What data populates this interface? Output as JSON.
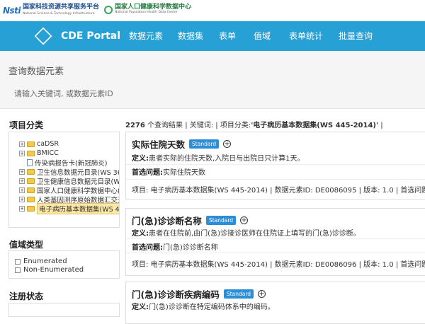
{
  "header": {
    "logo1": {
      "mark": "Nsti",
      "cn": "国家科技资源共享服务平台",
      "en": "National Science & Technology Infrastructure"
    },
    "logo2": {
      "cn": "国家人口健康科学数据中心",
      "en": "National Population Health Data Center"
    }
  },
  "navbar": {
    "brand": "CDE Portal",
    "items": [
      "数据元素",
      "数据集",
      "表单",
      "值域",
      "表单统计",
      "批量查询"
    ]
  },
  "search": {
    "title": "查询数据元素",
    "placeholder": "请输入关键词, 或数据元素ID"
  },
  "sidebar": {
    "category_title": "项目分类",
    "tree": [
      {
        "label": "caDSR",
        "type": "folder"
      },
      {
        "label": "BMICC",
        "type": "folder"
      },
      {
        "label": "传染病报告卡(新冠肺炎)",
        "type": "doc"
      },
      {
        "label": "卫生信息数据元目录(WS 363-",
        "type": "folder"
      },
      {
        "label": "卫生健康信息数据元目录(WS/T",
        "type": "folder"
      },
      {
        "label": "国家人口健康科学数据中心(NC",
        "type": "folder"
      },
      {
        "label": "人类基因测序原始数据汇交元数",
        "type": "folder"
      },
      {
        "label": "电子病历基本数据集(WS 445-",
        "type": "folder",
        "selected": true
      }
    ],
    "domain_title": "值域类型",
    "domain_options": [
      "Enumerated",
      "Non-Enumerated"
    ],
    "reg_title": "注册状态"
  },
  "results": {
    "count": "2276",
    "summary": " 个查询结果 | 关键词: | 项目分类:",
    "category": "'电子病历基本数据集(WS 445-2014)'",
    "tail": " |"
  },
  "cards": [
    {
      "name": "实际住院天数",
      "badge": "Standard",
      "def_label": "定义:",
      "definition": "患者实际的住院天数,入院日与出院日只计算1天。",
      "pq_label": "首选问题:",
      "preferred_question": "实际住院天数",
      "meta": "项目: 电子病历基本数据集(WS 445-2014) | 数据元素ID: DE0086095 | 版本: 1.0 | 首选问题ID:"
    },
    {
      "name": "门(急)诊诊断名称",
      "badge": "Standard",
      "def_label": "定义:",
      "definition": "患者在住院前,由门(急)诊接诊医师在住院证上填写的门(急)诊诊断。",
      "pq_label": "首选问题:",
      "preferred_question": "门(急)诊诊断名称",
      "meta": "项目: 电子病历基本数据集(WS 445-2014) | 数据元素ID: DE0086096 | 版本: 1.0 | 首选问题ID:"
    },
    {
      "name": "门(急)诊诊断疾病编码",
      "badge": "Standard",
      "def_label": "定义:",
      "definition": "门(急)诊诊断在特定编码体系中的编码。"
    }
  ]
}
